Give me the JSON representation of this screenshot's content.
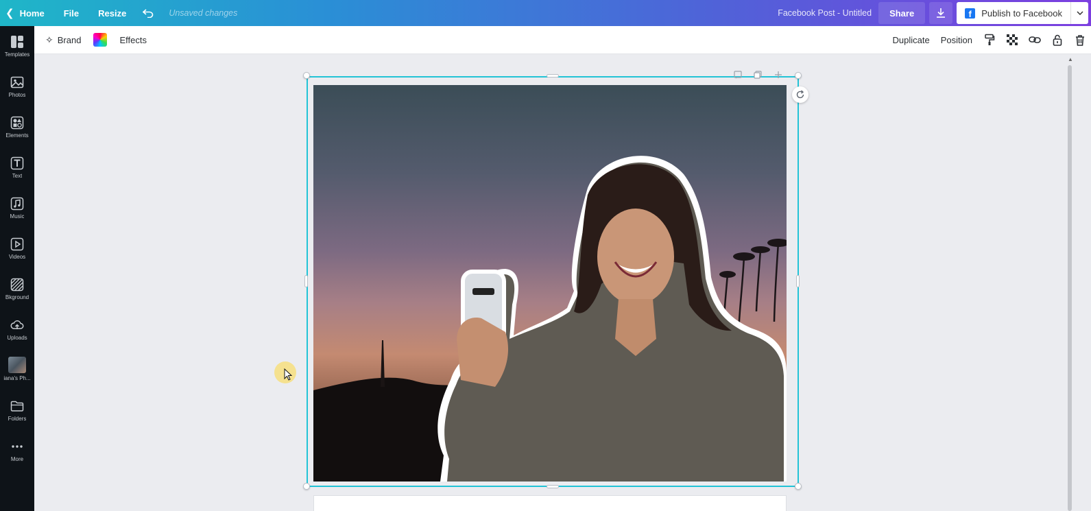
{
  "topbar": {
    "home_label": "Home",
    "file_label": "File",
    "resize_label": "Resize",
    "unsaved_label": "Unsaved changes",
    "doc_title": "Facebook Post - Untitled",
    "share_label": "Share",
    "publish_label": "Publish to Facebook",
    "icons": [
      "chevron-left-icon",
      "undo-icon",
      "download-icon",
      "facebook-icon",
      "chevron-down-icon"
    ]
  },
  "sidebar": {
    "items": [
      {
        "label": "Templates",
        "icon": "templates-icon"
      },
      {
        "label": "Photos",
        "icon": "photos-icon"
      },
      {
        "label": "Elements",
        "icon": "elements-icon"
      },
      {
        "label": "Text",
        "icon": "text-icon"
      },
      {
        "label": "Music",
        "icon": "music-icon"
      },
      {
        "label": "Videos",
        "icon": "videos-icon"
      },
      {
        "label": "Bkground",
        "icon": "background-icon"
      },
      {
        "label": "Uploads",
        "icon": "uploads-icon"
      },
      {
        "label": "iana's Ph...",
        "icon": "folder-thumbnail"
      },
      {
        "label": "Folders",
        "icon": "folders-icon"
      },
      {
        "label": "More",
        "icon": "more-icon"
      }
    ]
  },
  "toolbar": {
    "brand_label": "Brand",
    "effects_label": "Effects",
    "duplicate_label": "Duplicate",
    "position_label": "Position",
    "icons": [
      "sparkle-icon",
      "color-picker-icon",
      "paint-roller-icon",
      "transparency-icon",
      "link-icon",
      "lock-icon",
      "trash-icon"
    ]
  },
  "colors": {
    "accent": "#22c3d6",
    "sidebar_bg": "#0e1318",
    "canvas_bg": "#ebecf0",
    "facebook_blue": "#1877f2"
  }
}
